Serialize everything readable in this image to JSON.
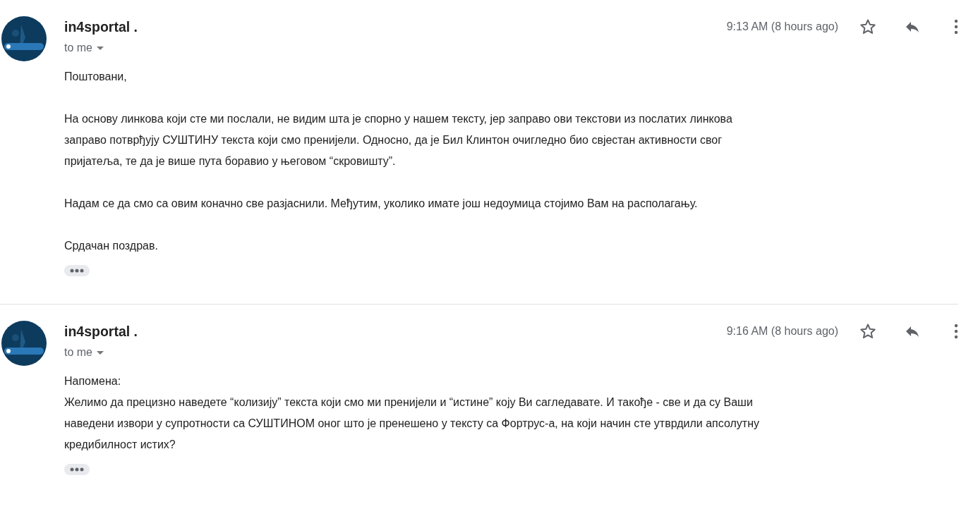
{
  "messages": [
    {
      "sender": "in4sportal .",
      "recipient": "to me",
      "time": "9:13 AM (8 hours ago)",
      "paragraphs": [
        [
          "Поштовани,"
        ],
        [
          "На основу линкова који сте ми послали, не видим шта је спорно у нашем тексту, јер заправо ови текстови из послатих линкова",
          "заправо потврђују СУШТИНУ текста који смо пренијели. Односно, да је Бил Клинтон очигледно био свјестан активности свог",
          "пријатеља, те да је више пута боравио у његовом “скровишту”."
        ],
        [
          "Надам се да смо са овим коначно све разјаснили. Међутим, уколико имате још недоумица стојимо Вам на располагању."
        ],
        [
          "Срдачан поздрав."
        ]
      ]
    },
    {
      "sender": "in4sportal .",
      "recipient": "to me",
      "time": "9:16 AM (8 hours ago)",
      "paragraphs": [
        [
          "Напомена:",
          "Желимо да прецизно наведете “колизију” текста који смо ми пренијели и “истине” коју Ви сагледавате. И такође - све и да су Ваши",
          "наведени извори у супротности са СУШТИНОМ оног што је пренешено у тексту са Фортрус-а, на који начин сте утврдили апсолутну",
          "кредибилност истих?"
        ]
      ]
    }
  ]
}
